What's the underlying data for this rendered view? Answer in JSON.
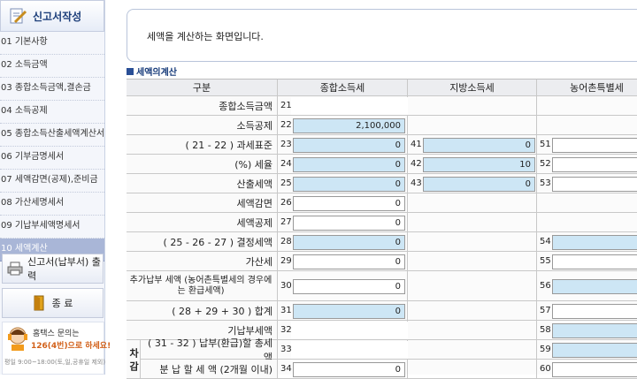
{
  "sidebar": {
    "header": "신고서작성",
    "items": [
      {
        "label": "01 기본사항"
      },
      {
        "label": "02 소득금액"
      },
      {
        "label": "03 종합소득금액,결손금"
      },
      {
        "label": "04 소득공제"
      },
      {
        "label": "05 종합소득산출세액계산서"
      },
      {
        "label": "06 기부금명세서"
      },
      {
        "label": "07 세액감면(공제),준비금"
      },
      {
        "label": "08 가산세명세서"
      },
      {
        "label": "09 기납부세액명세서"
      },
      {
        "label": "10 세액계산"
      }
    ],
    "print_button": "신고서(납부서) 출력",
    "exit_button": "종 료",
    "help": {
      "line1": "홈택스 문의는",
      "line2": "126(4번)으로 하세요!",
      "line3": "평일 9:00~18:00(토,일,공휴일 제외)"
    }
  },
  "main": {
    "description": "세액을 계산하는 화면입니다.",
    "section_title": "세액의계산",
    "headers": {
      "gubun": "구분",
      "income": "종합소득세",
      "local": "지방소득세",
      "rural": "농어촌특별세"
    },
    "rows": [
      {
        "label": "종합소득금액",
        "n1": "21",
        "v1": "",
        "n2": "",
        "v2": "",
        "n3": "",
        "v3": ""
      },
      {
        "label": "소득공제",
        "n1": "22",
        "v1": "2,100,000",
        "n2": "",
        "v2": "",
        "n3": "",
        "v3": ""
      },
      {
        "label": "( 21 - 22 ) 과세표준",
        "n1": "23",
        "v1": "0",
        "n2": "41",
        "v2": "0",
        "n3": "51",
        "v3": ""
      },
      {
        "label": "(%) 세율",
        "n1": "24",
        "v1": "0",
        "n2": "42",
        "v2": "10",
        "n3": "52",
        "v3": ""
      },
      {
        "label": "산출세액",
        "n1": "25",
        "v1": "0",
        "n2": "43",
        "v2": "0",
        "n3": "53",
        "v3": ""
      },
      {
        "label": "세액감면",
        "n1": "26",
        "v1": "0",
        "n2": "",
        "v2": "",
        "n3": "",
        "v3": ""
      },
      {
        "label": "세액공제",
        "n1": "27",
        "v1": "0",
        "n2": "",
        "v2": "",
        "n3": "",
        "v3": ""
      },
      {
        "label": "( 25 - 26 - 27 ) 결정세액",
        "n1": "28",
        "v1": "0",
        "n2": "",
        "v2": "",
        "n3": "54",
        "v3": ""
      },
      {
        "label": "가산세",
        "n1": "29",
        "v1": "0",
        "n2": "",
        "v2": "",
        "n3": "55",
        "v3": ""
      },
      {
        "label": "추가납부 세액 (농어촌특별세의 경우에는 환급세액)",
        "n1": "30",
        "v1": "0",
        "n2": "",
        "v2": "",
        "n3": "56",
        "v3": ""
      },
      {
        "label": "( 28 + 29 + 30 ) 합계",
        "n1": "31",
        "v1": "0",
        "n2": "",
        "v2": "",
        "n3": "57",
        "v3": ""
      },
      {
        "label": "기납부세액",
        "n1": "32",
        "v1": "",
        "n2": "",
        "v2": "",
        "n3": "58",
        "v3": ""
      },
      {
        "label": "( 31 - 32 ) 납부(환급)할 총세액",
        "n1": "33",
        "v1": "",
        "n2": "",
        "v2": "",
        "n3": "59",
        "v3": ""
      },
      {
        "label": "분 납 할 세 액 (2개월 이내)",
        "n1": "34",
        "v1": "0",
        "n2": "",
        "v2": "",
        "n3": "60",
        "v3": ""
      }
    ],
    "side_label": "차 감"
  }
}
